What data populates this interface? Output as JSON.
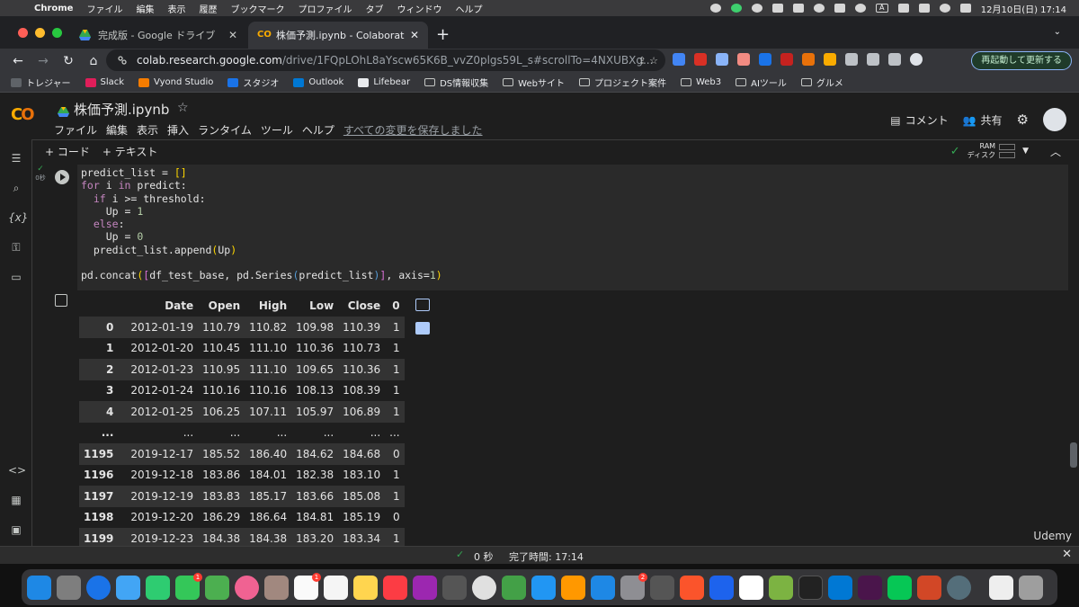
{
  "menubar": {
    "app": "Chrome",
    "items": [
      "ファイル",
      "編集",
      "表示",
      "履歴",
      "ブックマーク",
      "プロファイル",
      "タブ",
      "ウィンドウ",
      "ヘルプ"
    ],
    "datetime": "12月10日(日)  17:14"
  },
  "tabs": [
    {
      "label": "完成版 - Google ドライブ",
      "active": false
    },
    {
      "label": "株価予測.ipynb - Colaboratory",
      "active": true
    }
  ],
  "address": {
    "host": "colab.research.google.com",
    "path": "/drive/1FQpLOhL8aYscw65K6B_vvZ0plgs59L_s#scrollTo=4NXUBXg...",
    "restart_label": "再起動して更新する"
  },
  "bookmarks": [
    "トレジャー",
    "Slack",
    "Vyond Studio",
    "スタジオ",
    "Outlook",
    "Lifebear",
    "DS情報収集",
    "Webサイト",
    "プロジェクト案件",
    "Web3",
    "AIツール",
    "グルメ"
  ],
  "colab": {
    "notebook_title": "株価予測.ipynb",
    "menu": [
      "ファイル",
      "編集",
      "表示",
      "挿入",
      "ランタイム",
      "ツール",
      "ヘルプ"
    ],
    "saved_status": "すべての変更を保存しました",
    "comment_label": "コメント",
    "share_label": "共有",
    "add_code": "+ コード",
    "add_text": "+ テキスト",
    "ram_label": "RAM",
    "disk_label": "ディスク",
    "exec_time_badge": "0秒"
  },
  "code_lines": [
    "predict_list = []",
    "for i in predict:",
    "  if i >= threshold:",
    "    Up = 1",
    "  else:",
    "    Up = 0",
    "  predict_list.append(Up)",
    "",
    "pd.concat([df_test_base, pd.Series(predict_list)], axis=1)"
  ],
  "dataframe": {
    "columns": [
      "",
      "Date",
      "Open",
      "High",
      "Low",
      "Close",
      "0"
    ],
    "rows": [
      [
        "0",
        "2012-01-19",
        "110.79",
        "110.82",
        "109.98",
        "110.39",
        "1"
      ],
      [
        "1",
        "2012-01-20",
        "110.45",
        "111.10",
        "110.36",
        "110.73",
        "1"
      ],
      [
        "2",
        "2012-01-23",
        "110.95",
        "111.10",
        "109.65",
        "110.36",
        "1"
      ],
      [
        "3",
        "2012-01-24",
        "110.16",
        "110.16",
        "108.13",
        "108.39",
        "1"
      ],
      [
        "4",
        "2012-01-25",
        "106.25",
        "107.11",
        "105.97",
        "106.89",
        "1"
      ],
      [
        "...",
        "...",
        "...",
        "...",
        "...",
        "...",
        "..."
      ],
      [
        "1195",
        "2019-12-17",
        "185.52",
        "186.40",
        "184.62",
        "184.68",
        "0"
      ],
      [
        "1196",
        "2019-12-18",
        "183.86",
        "184.01",
        "182.38",
        "183.10",
        "1"
      ],
      [
        "1197",
        "2019-12-19",
        "183.83",
        "185.17",
        "183.66",
        "185.08",
        "1"
      ],
      [
        "1198",
        "2019-12-20",
        "186.29",
        "186.64",
        "184.81",
        "185.19",
        "0"
      ],
      [
        "1199",
        "2019-12-23",
        "184.38",
        "184.38",
        "183.20",
        "183.34",
        "1"
      ]
    ]
  },
  "statusbar": {
    "elapsed": "0 秒",
    "completed": "完了時間: 17:14"
  },
  "watermark": "Udemy"
}
